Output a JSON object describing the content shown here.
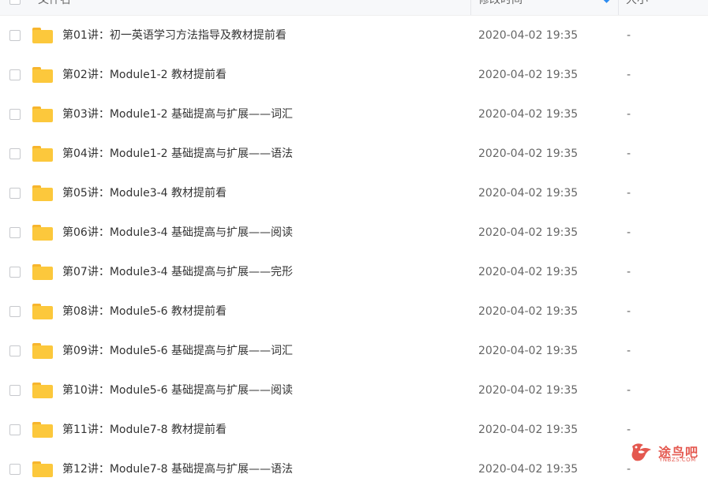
{
  "header": {
    "name_label": "文件名",
    "date_label": "修改时间",
    "size_label": "大小"
  },
  "rows": [
    {
      "name": "第01讲：初一英语学习方法指导及教材提前看",
      "date": "2020-04-02 19:35",
      "size": "-"
    },
    {
      "name": "第02讲：Module1-2 教材提前看",
      "date": "2020-04-02 19:35",
      "size": "-"
    },
    {
      "name": "第03讲：Module1-2 基础提高与扩展——词汇",
      "date": "2020-04-02 19:35",
      "size": "-"
    },
    {
      "name": "第04讲：Module1-2 基础提高与扩展——语法",
      "date": "2020-04-02 19:35",
      "size": "-"
    },
    {
      "name": "第05讲：Module3-4 教材提前看",
      "date": "2020-04-02 19:35",
      "size": "-"
    },
    {
      "name": "第06讲：Module3-4 基础提高与扩展——阅读",
      "date": "2020-04-02 19:35",
      "size": "-"
    },
    {
      "name": "第07讲：Module3-4 基础提高与扩展——完形",
      "date": "2020-04-02 19:35",
      "size": "-"
    },
    {
      "name": "第08讲：Module5-6 教材提前看",
      "date": "2020-04-02 19:35",
      "size": "-"
    },
    {
      "name": "第09讲：Module5-6 基础提高与扩展——词汇",
      "date": "2020-04-02 19:35",
      "size": "-"
    },
    {
      "name": "第10讲：Module5-6 基础提高与扩展——阅读",
      "date": "2020-04-02 19:35",
      "size": "-"
    },
    {
      "name": "第11讲：Module7-8 教材提前看",
      "date": "2020-04-02 19:35",
      "size": "-"
    },
    {
      "name": "第12讲：Module7-8 基础提高与扩展——语法",
      "date": "2020-04-02 19:35",
      "size": "-"
    }
  ],
  "watermark": {
    "text": "途鸟吧",
    "sub": "YNBZS.COM"
  },
  "colors": {
    "folder": "#fcc83c",
    "folder_tab": "#f7b52d",
    "sort_accent": "#2d8cf0",
    "watermark": "#e03c31"
  },
  "icons": {
    "folder": "folder-icon",
    "sort": "sort-desc-icon",
    "checkbox": "checkbox-icon"
  }
}
